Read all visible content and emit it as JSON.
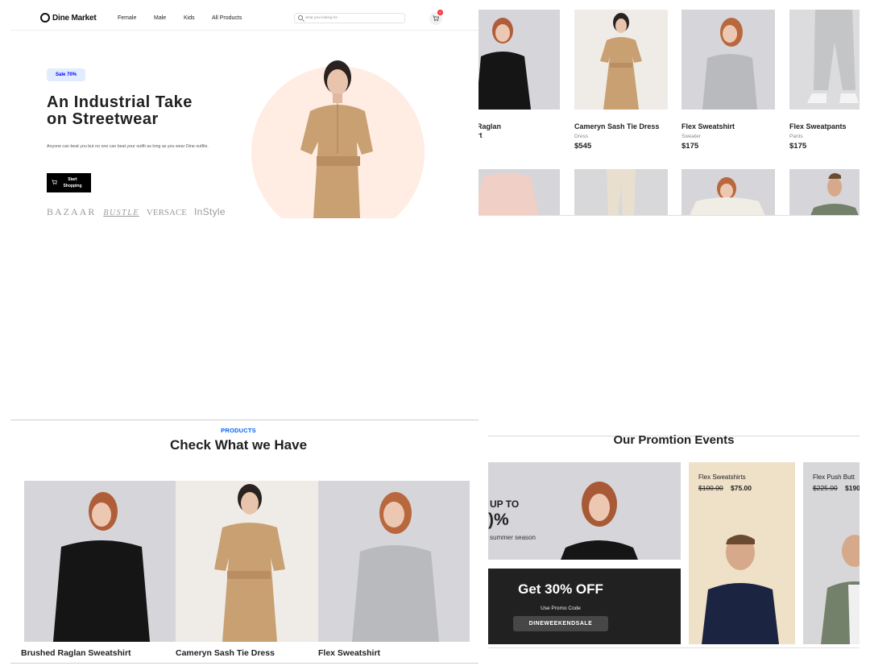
{
  "nav": {
    "logo": "Dine Market",
    "links": [
      "Female",
      "Male",
      "Kids",
      "All Products"
    ],
    "search_placeholder": "what you looking for",
    "cart_count": "0"
  },
  "hero": {
    "badge": "Sale 70%",
    "title_line1": "An Industrial Take",
    "title_line2": "on Streetwear",
    "description": "Anyone can beat you but no one can beat your outfit as long as you wear Dine outfits.",
    "cta_line1": "Start",
    "cta_line2": "Shopping",
    "brands": [
      "BAZAAR",
      "BUSTLE",
      "VERSACE",
      "InStyle"
    ]
  },
  "slider": {
    "products": [
      {
        "name": "ed Raglan",
        "name2": "shirt",
        "category": "r",
        "price": ""
      },
      {
        "name": "Cameryn Sash Tie Dress",
        "name2": "",
        "category": "Dress",
        "price": "$545"
      },
      {
        "name": "Flex Sweatshirt",
        "name2": "",
        "category": "Sweater",
        "price": "$175"
      },
      {
        "name": "Flex Sweatpants",
        "name2": "",
        "category": "Pants",
        "price": "$175"
      }
    ]
  },
  "products_section": {
    "label": "PRODUCTS",
    "title": "Check What we Have",
    "items": [
      "Brushed Raglan Sweatshirt",
      "Cameryn Sash Tie Dress",
      "Flex Sweatshirt"
    ]
  },
  "promo": {
    "title": "Our Promtion Events",
    "sale_heading": "UP TO",
    "sale_percent": ")%",
    "sale_note": "summer season",
    "code_heading": "Get 30% OFF",
    "code_label": "Use Promo Code",
    "code_value": "DINEWEEKENDSALE",
    "tiles": [
      {
        "name": "Flex Sweatshirts",
        "old_price": "$100.00",
        "new_price": "$75.00",
        "bg": "#efe1c7"
      },
      {
        "name": "Flex Push Butt",
        "old_price": "$225.00",
        "new_price": "$190",
        "bg": "#d7d7d9"
      }
    ]
  },
  "colors": {
    "accent_blue": "#0062f5",
    "badge_bg": "#e1edff",
    "hero_circle": "#ffece3",
    "cart_badge": "#f02d34",
    "dark": "#212121"
  }
}
